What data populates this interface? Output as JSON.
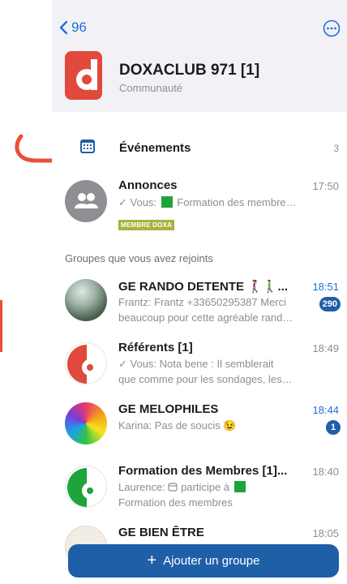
{
  "header": {
    "back_count": "96",
    "title": "DOXACLUB 971 [1]",
    "subtitle": "Communauté"
  },
  "events": {
    "label": "Événements",
    "count": "3"
  },
  "announcements": {
    "name": "Annonces",
    "time": "17:50",
    "preview": "✓ Vous:",
    "preview_rest": "Formation des membre…",
    "tag": "MEMBRE DOXA"
  },
  "section_label": "Groupes que vous avez rejoints",
  "chats": [
    {
      "name": "GE RANDO DETENTE 🚶‍♀️🚶‍♂️...",
      "time": "18:51",
      "line1": "Frantz: Frantz +33650295387 Merci",
      "line2": "beaucoup pour cette agréable rand…",
      "badge": "290"
    },
    {
      "name": "Référents [1]",
      "time": "18:49",
      "line1": "✓ Vous: Nota bene :  Il semblerait",
      "line2": "que comme pour les sondages, les…"
    },
    {
      "name": "GE MELOPHILES",
      "time": "18:44",
      "line1": "Karina: Pas de soucis 😉",
      "badge": "1"
    },
    {
      "name": "Formation des Membres [1]...",
      "time": "18:40",
      "line1_a": "Laurence:",
      "line1_b": "participe à",
      "line2": "Formation des membres"
    },
    {
      "name": "GE BIEN ÊTRE",
      "time": "18:05"
    }
  ],
  "add_button": "Ajouter un groupe",
  "colors": {
    "accent": "#1e5fa8",
    "link": "#1e6fd9",
    "logo_red": "#e0493b",
    "logo_green": "#1ea43a",
    "tag": "#a8b33e",
    "annotation_arrow": "#e8503a"
  },
  "icons": [
    "back-chevron-icon",
    "more-icon",
    "calendar-icon",
    "group-icon",
    "plus-icon"
  ]
}
